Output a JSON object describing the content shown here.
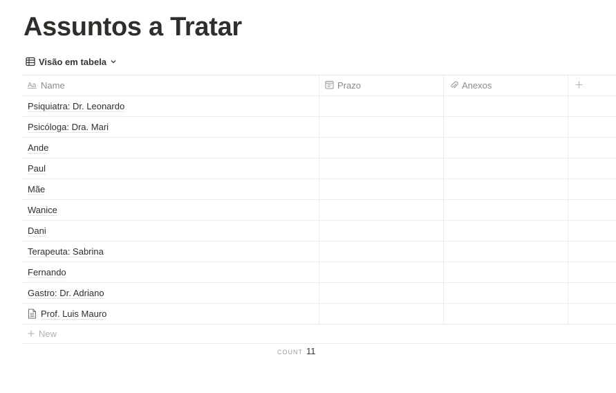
{
  "page": {
    "title": "Assuntos a Tratar"
  },
  "view": {
    "label": "Visão em tabela",
    "icon": "table-icon"
  },
  "table": {
    "columns": [
      {
        "label": "Name",
        "icon": "text-aa-icon"
      },
      {
        "label": "Prazo",
        "icon": "calendar-icon"
      },
      {
        "label": "Anexos",
        "icon": "paperclip-icon"
      },
      {
        "label": "+",
        "icon": "plus-icon"
      }
    ],
    "rows": [
      {
        "name": "Psiquiatra: Dr. Leonardo",
        "prazo": "",
        "anexos": ""
      },
      {
        "name": "Psicóloga: Dra. Mari",
        "prazo": "",
        "anexos": ""
      },
      {
        "name": "Ande",
        "prazo": "",
        "anexos": ""
      },
      {
        "name": "Paul",
        "prazo": "",
        "anexos": ""
      },
      {
        "name": "Mãe",
        "prazo": "",
        "anexos": ""
      },
      {
        "name": "Wanice",
        "prazo": "",
        "anexos": ""
      },
      {
        "name": "Dani",
        "prazo": "",
        "anexos": ""
      },
      {
        "name": "Terapeuta: Sabrina",
        "prazo": "",
        "anexos": ""
      },
      {
        "name": "Fernando",
        "prazo": "",
        "anexos": ""
      },
      {
        "name": "Gastro: Dr. Adriano",
        "prazo": "",
        "anexos": ""
      },
      {
        "name": "Prof. Luis Mauro",
        "prazo": "",
        "anexos": "",
        "icon": "document-icon"
      }
    ],
    "new_label": "New",
    "count_label": "COUNT",
    "count_value": "11"
  },
  "colors": {
    "text": "#37352f",
    "muted": "#8b8a86",
    "border": "#ebebea"
  }
}
